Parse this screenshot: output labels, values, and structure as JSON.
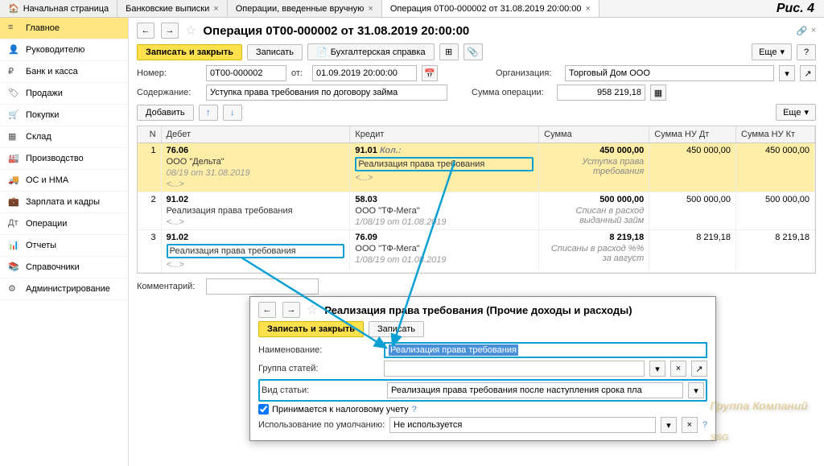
{
  "figure_label": "Рис. 4",
  "tabs": [
    {
      "label": "Начальная страница",
      "closable": false,
      "icon": "home"
    },
    {
      "label": "Банковские выписки",
      "closable": true
    },
    {
      "label": "Операции, введенные вручную",
      "closable": true
    },
    {
      "label": "Операция 0Т00-000002 от 31.08.2019 20:00:00",
      "closable": true,
      "active": true
    }
  ],
  "sidebar": [
    {
      "label": "Главное",
      "hl": true
    },
    {
      "label": "Руководителю"
    },
    {
      "label": "Банк и касса"
    },
    {
      "label": "Продажи"
    },
    {
      "label": "Покупки"
    },
    {
      "label": "Склад"
    },
    {
      "label": "Производство"
    },
    {
      "label": "ОС и НМА"
    },
    {
      "label": "Зарплата и кадры"
    },
    {
      "label": "Операции"
    },
    {
      "label": "Отчеты"
    },
    {
      "label": "Справочники"
    },
    {
      "label": "Администрирование"
    }
  ],
  "header": {
    "title": "Операция 0Т00-000002 от 31.08.2019 20:00:00",
    "save_close": "Записать и закрыть",
    "save": "Записать",
    "accounting_ref": "Бухгалтерская справка",
    "more": "Еще",
    "help": "?"
  },
  "fields": {
    "number_label": "Номер:",
    "number": "0Т00-000002",
    "from_label": "от:",
    "date": "01.09.2019 20:00:00",
    "org_label": "Организация:",
    "org": "Торговый Дом ООО",
    "desc_label": "Содержание:",
    "desc": "Уступка права требования по договору займа",
    "sum_label": "Сумма операции:",
    "sum": "958 219,18",
    "add": "Добавить",
    "comment_label": "Комментарий:"
  },
  "table": {
    "headers": {
      "n": "N",
      "debit": "Дебет",
      "credit": "Кредит",
      "sum": "Сумма",
      "nu_dt": "Сумма НУ Дт",
      "nu_kt": "Сумма НУ Кт"
    },
    "rows": [
      {
        "n": "1",
        "hl": true,
        "debit": {
          "l1": "76.06",
          "l2": "ООО \"Дельта\"",
          "l3": "08/19 от 31.08.2019",
          "l4": "<...>"
        },
        "credit": {
          "l1": "91.01",
          "note": "Кол.:",
          "l2": "Реализация права требования",
          "l2_hl": true,
          "l3": "<...>"
        },
        "sum": "450 000,00",
        "sum_note": "Уступка права требования",
        "nu_dt": "450 000,00",
        "nu_kt": "450 000,00"
      },
      {
        "n": "2",
        "debit": {
          "l1": "91.02",
          "l2": "Реализация права требования",
          "l3": "<...>"
        },
        "credit": {
          "l1": "58.03",
          "l2": "ООО \"ТФ-Мега\"",
          "l3": "1/08/19 от 01.08.2019"
        },
        "sum": "500 000,00",
        "sum_note": "Списан в расход выданный займ",
        "nu_dt": "500 000,00",
        "nu_kt": "500 000,00"
      },
      {
        "n": "3",
        "debit": {
          "l1": "91.02",
          "l2": "Реализация права требования",
          "l2_hl": true,
          "l3": "<...>"
        },
        "credit": {
          "l1": "76.09",
          "l2": "ООО \"ТФ-Мега\"",
          "l3": "1/08/19 от 01.08.2019"
        },
        "sum": "8 219,18",
        "sum_note": "Списаны в расход %% за август",
        "nu_dt": "8 219,18",
        "nu_kt": "8 219,18"
      }
    ]
  },
  "popup": {
    "title": "Реализация права требования (Прочие доходы и расходы)",
    "save_close": "Записать и закрыть",
    "save": "Записать",
    "name_label": "Наименование:",
    "name": "Реализация права требования",
    "group_label": "Группа статей:",
    "group": "",
    "type_label": "Вид статьи:",
    "type": "Реализация права требования после наступления срока пла",
    "tax_check": "Принимается к налоговому учету",
    "default_label": "Использование по умолчанию:",
    "default": "Не используется"
  },
  "watermark": {
    "sub": "Группа Компаний",
    "main": "SSG"
  }
}
